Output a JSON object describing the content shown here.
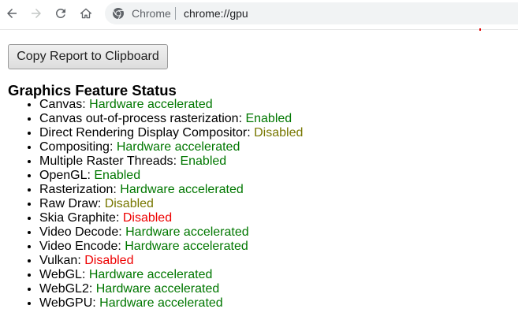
{
  "browser": {
    "chip_label": "Chrome",
    "url": "chrome://gpu"
  },
  "page": {
    "copy_button_label": "Copy Report to Clipboard",
    "section_title": "Graphics Feature Status",
    "features": [
      {
        "name": "Canvas",
        "status": "Hardware accelerated",
        "level": "ok"
      },
      {
        "name": "Canvas out-of-process rasterization",
        "status": "Enabled",
        "level": "ok"
      },
      {
        "name": "Direct Rendering Display Compositor",
        "status": "Disabled",
        "level": "warn"
      },
      {
        "name": "Compositing",
        "status": "Hardware accelerated",
        "level": "ok"
      },
      {
        "name": "Multiple Raster Threads",
        "status": "Enabled",
        "level": "ok"
      },
      {
        "name": "OpenGL",
        "status": "Enabled",
        "level": "ok"
      },
      {
        "name": "Rasterization",
        "status": "Hardware accelerated",
        "level": "ok"
      },
      {
        "name": "Raw Draw",
        "status": "Disabled",
        "level": "warn"
      },
      {
        "name": "Skia Graphite",
        "status": "Disabled",
        "level": "off"
      },
      {
        "name": "Video Decode",
        "status": "Hardware accelerated",
        "level": "ok"
      },
      {
        "name": "Video Encode",
        "status": "Hardware accelerated",
        "level": "ok"
      },
      {
        "name": "Vulkan",
        "status": "Disabled",
        "level": "off"
      },
      {
        "name": "WebGL",
        "status": "Hardware accelerated",
        "level": "ok"
      },
      {
        "name": "WebGL2",
        "status": "Hardware accelerated",
        "level": "ok"
      },
      {
        "name": "WebGPU",
        "status": "Hardware accelerated",
        "level": "ok"
      }
    ]
  },
  "colors": {
    "status_enabled": "#007700",
    "status_disabled_software": "#777700",
    "status_disabled": "#ee0000"
  },
  "icons": [
    "back-arrow-icon",
    "forward-arrow-icon",
    "reload-icon",
    "home-icon",
    "chrome-logo-icon"
  ]
}
